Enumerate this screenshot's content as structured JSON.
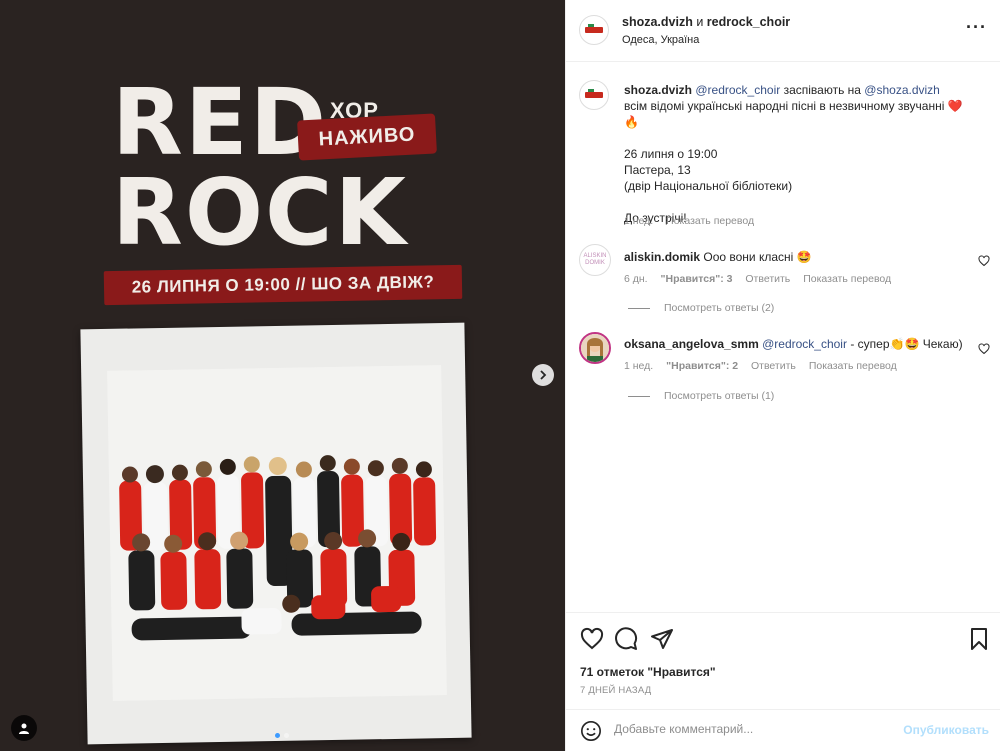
{
  "post": {
    "users": "shoza.dvizh",
    "and_word": "и",
    "coauthor": "redrock_choir",
    "location": "Одеса, Україна",
    "more_icon": "more-horizontal-icon"
  },
  "poster": {
    "line1": "RED",
    "line2": "ROCK",
    "hor": "ХОР",
    "nazhyvo": "НАЖИВО",
    "date": "26 ЛИПНЯ О 19:00 // ШО ЗА ДВІЖ?",
    "logo_text": "ШО ЗА ДВІЖ?"
  },
  "caption": {
    "user": "shoza.dvizh",
    "mention1": "@redrock_choir",
    "text1": " заспівають на ",
    "mention2": "@shoza.dvizh",
    "text2": " всім відомі українські народні пісні в незвичному звучанні ",
    "emojis": "❤️🔥",
    "line_date": "26 липня о 19:00",
    "line_address": "Пастера, 13",
    "line_place": "(двір Національної бібліотеки)",
    "line_bye": "До зустрічі!",
    "age": "1 нед.",
    "translate": "Показать перевод"
  },
  "comments": [
    {
      "user": "aliskin.domik",
      "avatar_text": "ALISKIN DOMIK",
      "text": " Ооо вони класні ",
      "emoji": "🤩",
      "age": "6 дн.",
      "likes": "\"Нравится\": 3",
      "reply": "Ответить",
      "translate": "Показать перевод",
      "view_replies": "Посмотреть ответы (2)"
    },
    {
      "user": "oksana_angelova_smm",
      "mention": "@redrock_choir",
      "text": " - супер",
      "emoji": "👏🤩",
      "text2": " Чекаю)",
      "age": "1 нед.",
      "likes": "\"Нравится\": 2",
      "reply": "Ответить",
      "translate": "Показать перевод",
      "view_replies": "Посмотреть ответы (1)"
    }
  ],
  "actions": {
    "like_icon": "heart-icon",
    "comment_icon": "comment-icon",
    "share_icon": "paper-plane-icon",
    "save_icon": "bookmark-icon",
    "likes": "71 отметок \"Нравится\"",
    "posted": "7 ДНЕЙ НАЗАД"
  },
  "comment_box": {
    "placeholder": "Добавьте комментарий...",
    "publish": "Опубликовать"
  },
  "colors": {
    "media_bg": "#2a2321",
    "poster_red": "#8a1a1a",
    "mention": "#385185",
    "publish_disabled": "#b2dffc"
  }
}
